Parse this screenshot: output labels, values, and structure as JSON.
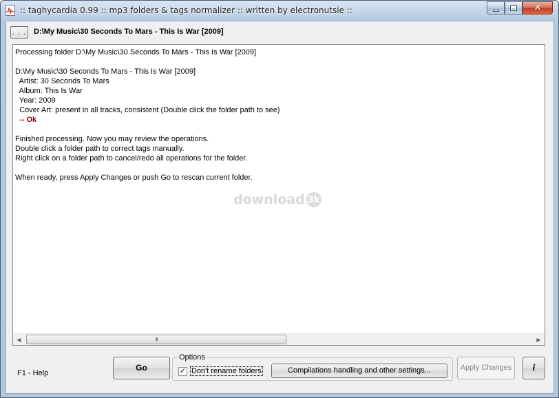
{
  "window": {
    "title": ":: taghycardia 0.99 :: mp3 folders & tags normalizer :: written by electronutsie ::",
    "close_glyph": "✕"
  },
  "toolbar": {
    "browse_label": ". . .",
    "current_path": "D:\\My Music\\30 Seconds To Mars - This Is War [2009]"
  },
  "log": {
    "processing_line": "Processing folder D:\\My Music\\30 Seconds To Mars - This Is War [2009]",
    "folder_path": "D:\\My Music\\30 Seconds To Mars - This Is War [2009]",
    "artist": "  Artist: 30 Seconds To Mars",
    "album": "  Album: This Is War",
    "year": "  Year: 2009",
    "cover_art": "  Cover Art: present in all tracks, consistent (Double click the folder path to see)",
    "status": "  -- Ok",
    "finished": "Finished processing. Now you may review the operations.",
    "hint_double_click": "Double click a folder path to correct tags manually.",
    "hint_right_click": "Right click on a folder path to cancel/redo all operations for the folder.",
    "hint_ready": "When ready, press Apply Changes or push Go to rescan current folder."
  },
  "watermark": {
    "text": "download",
    "badge": "3k"
  },
  "scrollbar": {
    "thumb_grip": "III",
    "left_arrow": "◀",
    "right_arrow": "▶"
  },
  "footer": {
    "help": "F1 - Help",
    "go_label": "Go",
    "options_title": "Options",
    "dont_rename_label": "Don't rename folders",
    "dont_rename_checked": true,
    "check_glyph": "✓",
    "settings_label": "Compilations handling and other settings...",
    "apply_label": "Apply Changes",
    "info_label": "i"
  }
}
